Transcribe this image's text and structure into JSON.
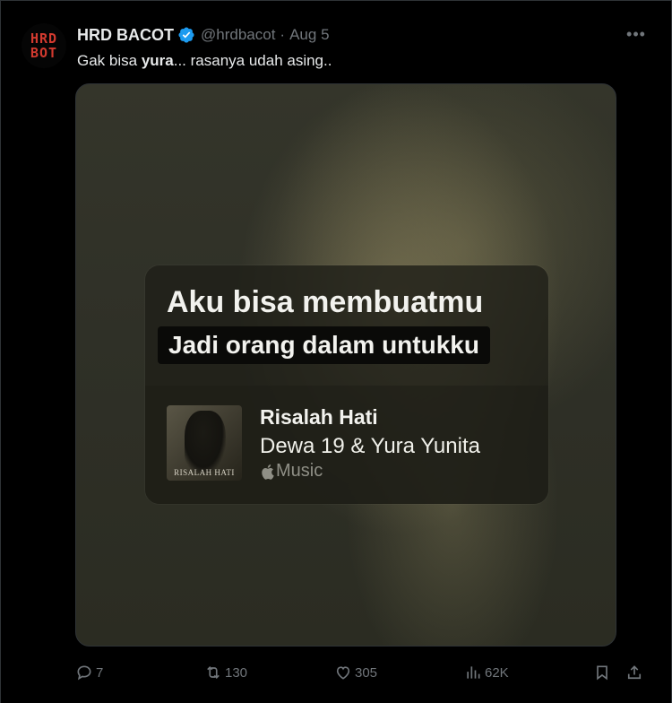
{
  "tweet": {
    "display_name": "HRD BACOT",
    "handle": "@hrdbacot",
    "separator": "·",
    "date": "Aug 5",
    "text_before": "Gak bisa ",
    "text_bold": "yura",
    "text_after": "... rasanya udah asing..",
    "avatar_text": {
      "line1": "HRD",
      "line2": "BOT"
    },
    "accent_color": "#1d9bf0"
  },
  "media": {
    "lyric_line_1": "Aku bisa membuatmu",
    "lyric_line_2": "Jadi orang dalam untukku",
    "song_title": "Risalah Hati",
    "artist": "Dewa 19 & Yura Yunita",
    "service": "Music",
    "cover_text": "RISALAH HATI"
  },
  "actions": {
    "replies": "7",
    "reposts": "130",
    "likes": "305",
    "views": "62K"
  }
}
